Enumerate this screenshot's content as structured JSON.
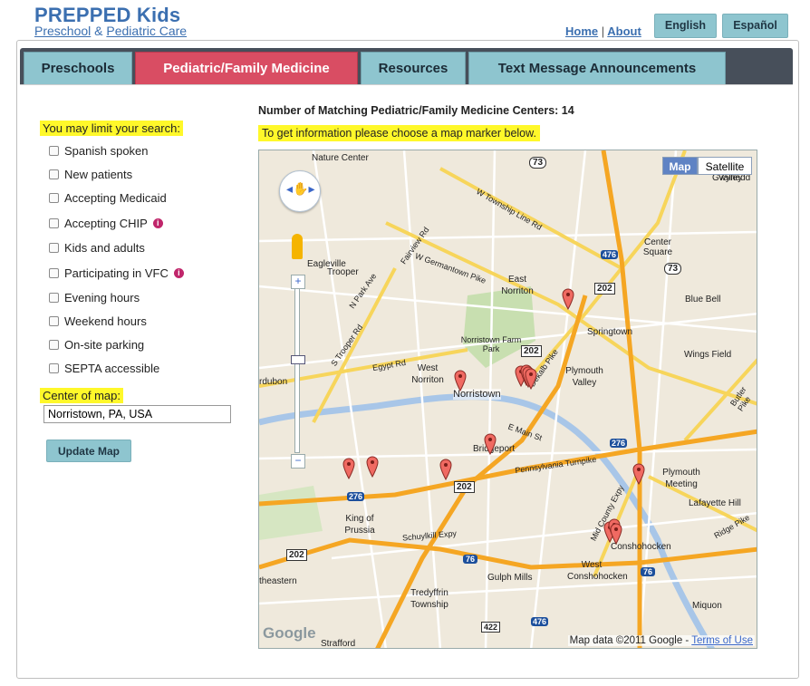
{
  "header": {
    "title": "PREPPED Kids",
    "subtitle_1": "Preschool",
    "subtitle_amp": " & ",
    "subtitle_2": "Pediatric Care",
    "home": "Home",
    "sep": "|",
    "about": "About",
    "lang_english": "English",
    "lang_espanol": "Español"
  },
  "tabs": [
    "Preschools",
    "Pediatric/Family Medicine",
    "Resources",
    "Text Message Announcements"
  ],
  "sidebar": {
    "limit_label": "You may limit your search:",
    "filters": [
      "Spanish spoken",
      "New patients",
      "Accepting Medicaid",
      "Accepting CHIP",
      "Kids and adults",
      "Participating in VFC",
      "Evening hours",
      "Weekend hours",
      "On-site parking",
      "SEPTA accessible"
    ],
    "info_glyph": "i",
    "center_label": "Center of map:",
    "center_value": "Norristown, PA, USA",
    "update_button": "Update Map"
  },
  "main": {
    "match_text": "Number of Matching Pediatric/Family Medicine Centers: 14",
    "instruction": "To get information please choose a map marker below."
  },
  "map": {
    "type_map": "Map",
    "type_satellite": "Satellite",
    "attribution": "Map data ©2011 Google - ",
    "terms": "Terms of Use",
    "logo": "Google",
    "labels": [
      "Nature Center",
      "Gwynedd Valley",
      "Gwynedd",
      "Center Square",
      "Eagleville",
      "Trooper",
      "East Norriton",
      "Blue Bell",
      "Springtown",
      "Norristown Farm Park",
      "West Norriton",
      "Norristown",
      "Plymouth Valley",
      "Wings Field",
      "Bridgeport",
      "Plymouth Meeting",
      "Lafayette Hill",
      "King of Prussia",
      "Conshohocken",
      "West Conshohocken",
      "Gulph Mills",
      "Tredyffrin Township",
      "Miquon",
      "Strafford",
      "theastern",
      "rdubon"
    ],
    "roads": [
      "W Township Line Rd",
      "W Germantown Pike",
      "Egypt Rd",
      "S Trooper Rd",
      "N Park Ave",
      "Fairview Rd",
      "Pennsylvania Turnpike",
      "Schuylkill Expy",
      "Dekalb Pike",
      "Mid County Expy",
      "Ridge Pike",
      "Butler Pike",
      "E Main St"
    ],
    "shields": [
      "73",
      "73",
      "476",
      "202",
      "202",
      "202",
      "276",
      "276",
      "76",
      "76",
      "476",
      "422",
      "202"
    ]
  }
}
